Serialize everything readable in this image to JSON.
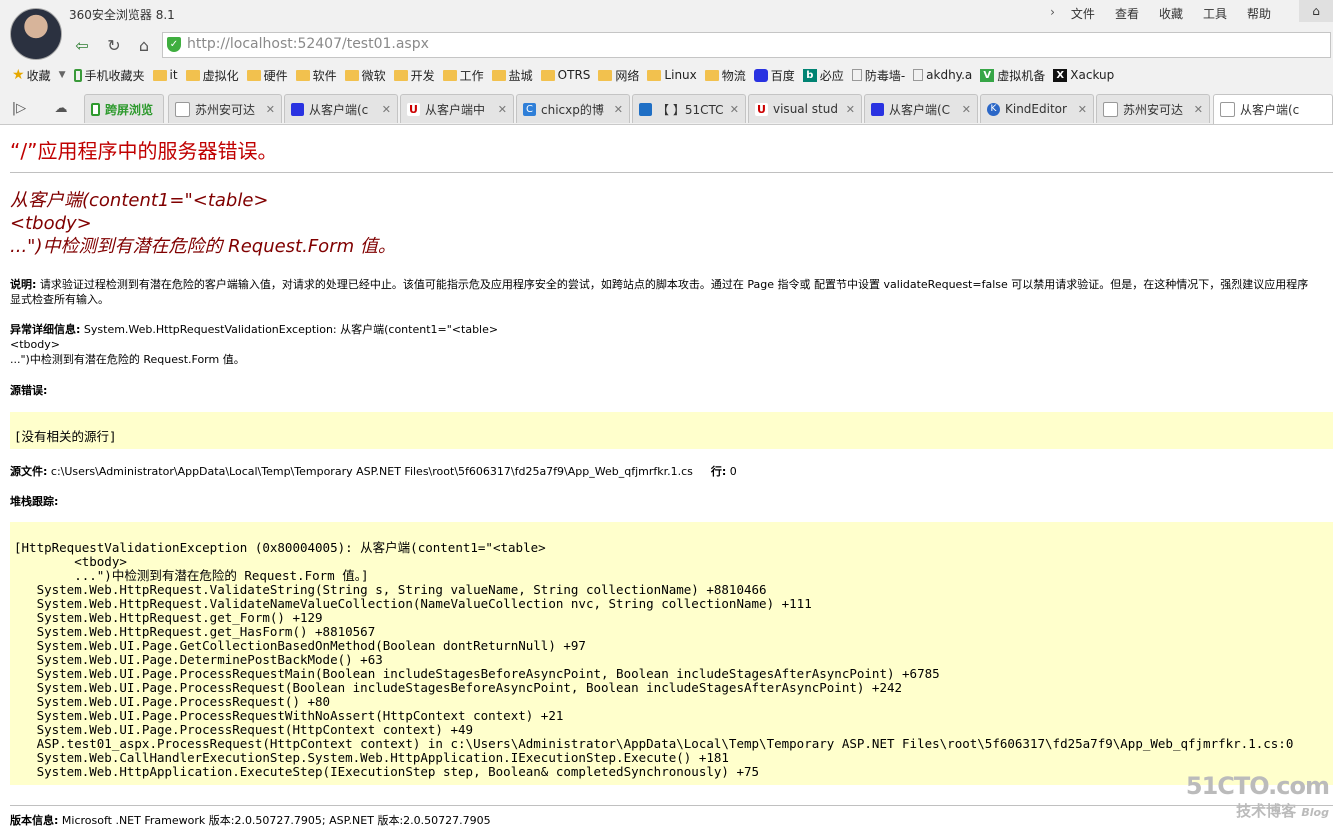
{
  "window": {
    "title": "360安全浏览器 8.1",
    "menu": [
      "文件",
      "查看",
      "收藏",
      "工具",
      "帮助"
    ]
  },
  "nav": {
    "url_host": "http://localhost",
    "url_rest": ":52407/test01.aspx"
  },
  "bookmarks": {
    "items": [
      {
        "label": "收藏",
        "icon": "star-icon"
      },
      {
        "label": "手机收藏夹",
        "icon": "phone-icon"
      },
      {
        "label": "it",
        "icon": "folder-icon"
      },
      {
        "label": "虚拟化",
        "icon": "folder-icon"
      },
      {
        "label": "硬件",
        "icon": "folder-icon"
      },
      {
        "label": "软件",
        "icon": "folder-icon"
      },
      {
        "label": "微软",
        "icon": "folder-icon"
      },
      {
        "label": "开发",
        "icon": "folder-icon"
      },
      {
        "label": "工作",
        "icon": "folder-icon"
      },
      {
        "label": "盐城",
        "icon": "folder-icon"
      },
      {
        "label": "OTRS",
        "icon": "folder-icon"
      },
      {
        "label": "网络",
        "icon": "folder-icon"
      },
      {
        "label": "Linux",
        "icon": "folder-icon"
      },
      {
        "label": "物流",
        "icon": "folder-icon"
      },
      {
        "label": "百度",
        "icon": "baidu-icon"
      },
      {
        "label": "必应",
        "icon": "bing-icon"
      },
      {
        "label": "防毒墙-",
        "icon": "page-icon"
      },
      {
        "label": "akdhy.a",
        "icon": "page-icon"
      },
      {
        "label": "虚拟机备",
        "icon": "veeam-icon"
      },
      {
        "label": "Xackup",
        "icon": "x-icon"
      }
    ]
  },
  "tabs": [
    {
      "label": "跨屏浏览",
      "icon": "phone-icon"
    },
    {
      "label": "苏州安可达",
      "icon": "page-icon"
    },
    {
      "label": "从客户端(c",
      "icon": "baidu-icon"
    },
    {
      "label": "从客户端中",
      "icon": "u-icon"
    },
    {
      "label": "chicxp的博",
      "icon": "c-icon"
    },
    {
      "label": "【 】51CTC",
      "icon": "home-icon"
    },
    {
      "label": "visual stud",
      "icon": "u-icon"
    },
    {
      "label": "从客户端(C",
      "icon": "baidu-icon"
    },
    {
      "label": "KindEditor",
      "icon": "k-icon"
    },
    {
      "label": "苏州安可达",
      "icon": "page-icon"
    },
    {
      "label": "从客户端(c",
      "icon": "page-icon"
    }
  ],
  "error": {
    "title": "“/”应用程序中的服务器错误。",
    "subtitle": "从客户端(content1=\"<table>\n<tbody>\n...\")中检测到有潜在危险的 Request.Form 值。",
    "desc_label": "说明:",
    "desc_text": " 请求验证过程检测到有潜在危险的客户端输入值，对请求的处理已经中止。该值可能指示危及应用程序安全的尝试，如跨站点的脚本攻击。通过在 Page 指令或 配置节中设置 validateRequest=false 可以禁用请求验证。但是，在这种情况下，强烈建议应用程序\n显式检查所有输入。",
    "exc_label": "异常详细信息:",
    "exc_text": " System.Web.HttpRequestValidationException: 从客户端(content1=\"<table>\n<tbody>\n...\")中检测到有潜在危险的 Request.Form 值。",
    "src_err_label": "源错误:",
    "src_err_code": "[没有相关的源行]",
    "src_file_label": "源文件:",
    "src_file_text": " c:\\Users\\Administrator\\AppData\\Local\\Temp\\Temporary ASP.NET Files\\root\\5f606317\\fd25a7f9\\App_Web_qfjmrfkr.1.cs",
    "line_label": "行:",
    "line_text": " 0",
    "stack_label": "堆栈跟踪:",
    "stack_trace": "[HttpRequestValidationException (0x80004005): 从客户端(content1=\"<table>\n        <tbody>\n        ...\")中检测到有潜在危险的 Request.Form 值。]\n   System.Web.HttpRequest.ValidateString(String s, String valueName, String collectionName) +8810466\n   System.Web.HttpRequest.ValidateNameValueCollection(NameValueCollection nvc, String collectionName) +111\n   System.Web.HttpRequest.get_Form() +129\n   System.Web.HttpRequest.get_HasForm() +8810567\n   System.Web.UI.Page.GetCollectionBasedOnMethod(Boolean dontReturnNull) +97\n   System.Web.UI.Page.DeterminePostBackMode() +63\n   System.Web.UI.Page.ProcessRequestMain(Boolean includeStagesBeforeAsyncPoint, Boolean includeStagesAfterAsyncPoint) +6785\n   System.Web.UI.Page.ProcessRequest(Boolean includeStagesBeforeAsyncPoint, Boolean includeStagesAfterAsyncPoint) +242\n   System.Web.UI.Page.ProcessRequest() +80\n   System.Web.UI.Page.ProcessRequestWithNoAssert(HttpContext context) +21\n   System.Web.UI.Page.ProcessRequest(HttpContext context) +49\n   ASP.test01_aspx.ProcessRequest(HttpContext context) in c:\\Users\\Administrator\\AppData\\Local\\Temp\\Temporary ASP.NET Files\\root\\5f606317\\fd25a7f9\\App_Web_qfjmrfkr.1.cs:0\n   System.Web.CallHandlerExecutionStep.System.Web.HttpApplication.IExecutionStep.Execute() +181\n   System.Web.HttpApplication.ExecuteStep(IExecutionStep step, Boolean& completedSynchronously) +75",
    "version_label": "版本信息:",
    "version_text": " Microsoft .NET Framework 版本:2.0.50727.7905; ASP.NET 版本:2.0.50727.7905"
  },
  "watermark": {
    "brand": "51CTO.com",
    "sub": "技术博客",
    "blog": "Blog"
  }
}
